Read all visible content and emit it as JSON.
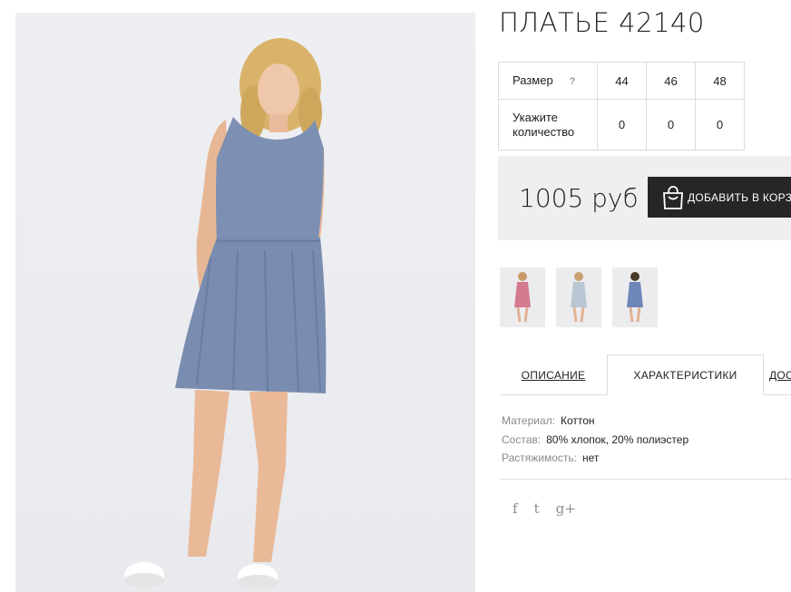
{
  "product": {
    "title": "ПЛАТЬЕ 42140",
    "main_image_alt": "dress-photo"
  },
  "size_table": {
    "size_label": "Размер",
    "help_label": "?",
    "sizes": [
      "44",
      "46",
      "48"
    ],
    "quantity_label": "Укажите количество",
    "quantities": [
      "0",
      "0",
      "0"
    ]
  },
  "purchase": {
    "price": "1005 руб",
    "add_button_label": "ДОБАВИТЬ В КОРЗИНУ",
    "icon": "shopping-bag-icon"
  },
  "thumbnails": [
    {
      "name": "pink",
      "color": "#d47a8e"
    },
    {
      "name": "light-blue",
      "color": "#b8c6d4"
    },
    {
      "name": "blue",
      "color": "#6f86b8"
    }
  ],
  "tabs": {
    "description": "ОПИСАНИЕ",
    "characteristics": "ХАРАКТЕРИСТИКИ",
    "delivery": "ДОСТАВКА"
  },
  "specs": [
    {
      "label": "Материал:",
      "value": "Коттон"
    },
    {
      "label": "Состав:",
      "value": "80% хлопок, 20% полиэстер"
    },
    {
      "label": "Растяжимость:",
      "value": "нет"
    }
  ],
  "social": {
    "facebook": "f",
    "twitter": "t",
    "google": "g+"
  },
  "colors": {
    "button_bg": "#262626",
    "price_bg": "#efefef",
    "dress": "#7a8db0"
  }
}
